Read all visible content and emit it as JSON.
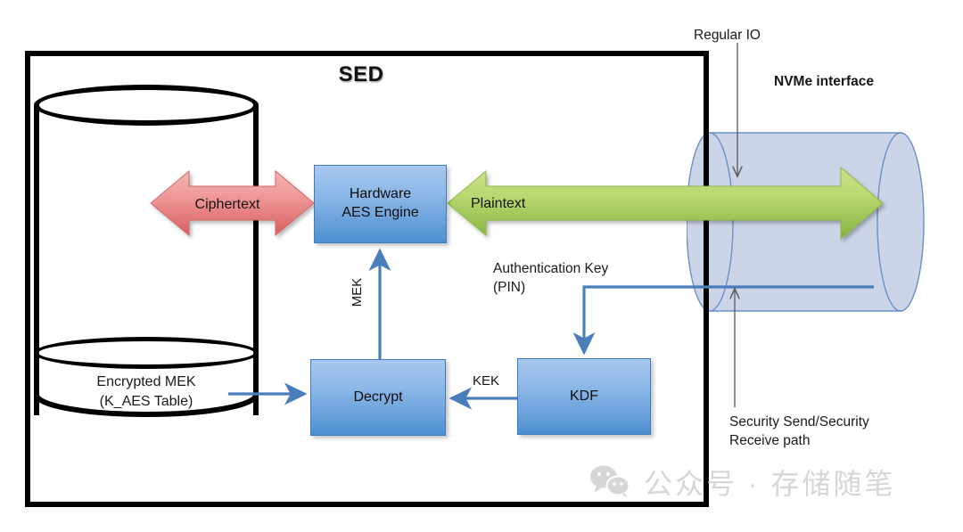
{
  "diagram": {
    "title": "SED",
    "enclosure_label": "SED"
  },
  "storage": {
    "encrypted_mek_line1": "Encrypted MEK",
    "encrypted_mek_line2": "(K_AES Table)",
    "fill_color": "#b9fbfb"
  },
  "blocks": {
    "aes_engine_line1": "Hardware",
    "aes_engine_line2": "AES Engine",
    "decrypt": "Decrypt",
    "kdf": "KDF",
    "box_fill_top": "#a8c8ee",
    "box_fill_bottom": "#4e8fd0",
    "box_border": "#3f7bbf"
  },
  "flows": {
    "ciphertext": "Ciphertext",
    "plaintext": "Plaintext",
    "mek": "MEK",
    "kek": "KEK",
    "auth_key_line1": "Authentication Key",
    "auth_key_line2": "(PIN)",
    "ciphertext_color": "#e88b8b",
    "plaintext_color": "#a8ce5c",
    "arrow_color": "#4a7ebb"
  },
  "interface": {
    "regular_io": "Regular IO",
    "nvme_interface": "NVMe interface",
    "security_path_line1": "Security Send/Security",
    "security_path_line2": "Receive path",
    "cylinder_fill": "#ccd5e8",
    "cylinder_stroke": "#6b8fc7"
  },
  "watermark": {
    "text": "公众号 · 存储随笔",
    "icon": "wechat-icon",
    "color": "#bdbdbd"
  }
}
